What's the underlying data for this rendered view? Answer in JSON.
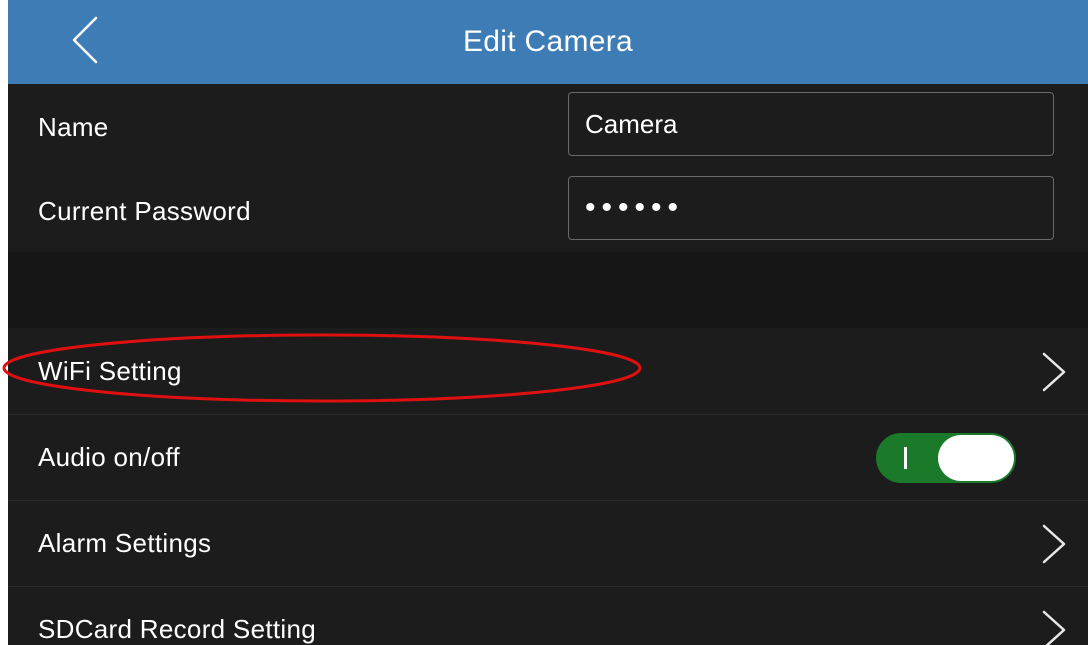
{
  "header": {
    "title": "Edit Camera",
    "back_icon": "chevron-left-icon"
  },
  "form": {
    "name_label": "Name",
    "name_value": "Camera",
    "password_label": "Current Password",
    "password_value": "••••••"
  },
  "settings": {
    "items": [
      {
        "label": "WiFi Setting",
        "icon": "chevron-right-icon"
      },
      {
        "label": "Audio on/off",
        "toggle_on": true,
        "toggle_text": "I"
      },
      {
        "label": "Alarm Settings",
        "icon": "chevron-right-icon"
      },
      {
        "label": "SDCard Record Setting",
        "icon": "chevron-right-icon"
      }
    ]
  },
  "colors": {
    "header_bg": "#3e7cb5",
    "screen_bg": "#1c1c1c",
    "toggle_on": "#1b7a2a",
    "highlight": "#e01010"
  }
}
